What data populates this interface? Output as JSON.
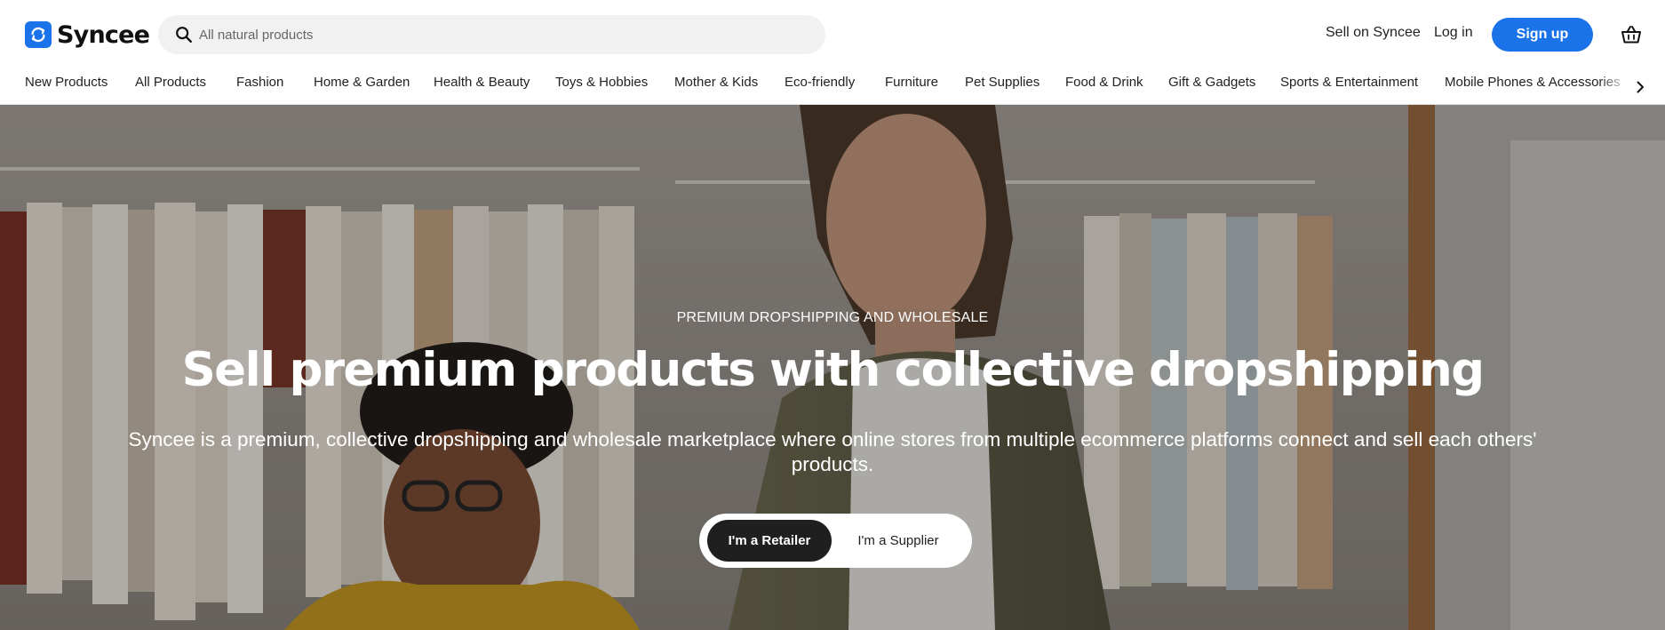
{
  "brand": {
    "name": "Syncee",
    "accent": "#1a73e8"
  },
  "search": {
    "placeholder": "All natural products"
  },
  "header": {
    "sell_link": "Sell on Syncee",
    "login_link": "Log in",
    "signup_button": "Sign up",
    "cart_icon": "basket-icon"
  },
  "categories": [
    {
      "label": "New Products"
    },
    {
      "label": "All Products"
    },
    {
      "label": "Fashion"
    },
    {
      "label": "Home & Garden"
    },
    {
      "label": "Health & Beauty"
    },
    {
      "label": "Toys & Hobbies"
    },
    {
      "label": "Mother & Kids"
    },
    {
      "label": "Eco-friendly"
    },
    {
      "label": "Furniture"
    },
    {
      "label": "Pet Supplies"
    },
    {
      "label": "Food & Drink"
    },
    {
      "label": "Gift & Gadgets"
    },
    {
      "label": "Sports & Entertainment"
    },
    {
      "label": "Mobile Phones & Accessories"
    }
  ],
  "hero": {
    "eyebrow": "PREMIUM DROPSHIPPING AND WHOLESALE",
    "title": "Sell premium products with collective dropshipping",
    "subtitle": "Syncee is a premium, collective dropshipping and wholesale marketplace where online stores from multiple ecommerce platforms connect and sell each others' products.",
    "toggle": {
      "retailer": "I'm a Retailer",
      "supplier": "I'm a Supplier",
      "selected": "retailer"
    }
  }
}
